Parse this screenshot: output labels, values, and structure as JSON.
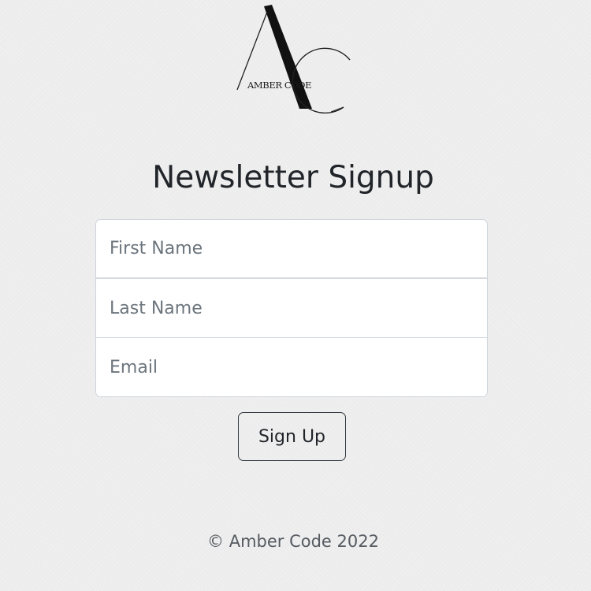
{
  "brand": {
    "logo_text": "AMBER CODE"
  },
  "title": "Newsletter Signup",
  "form": {
    "first_name_placeholder": "First Name",
    "last_name_placeholder": "Last Name",
    "email_placeholder": "Email",
    "submit_label": "Sign Up"
  },
  "footer": {
    "copyright": "© Amber Code 2022"
  },
  "colors": {
    "background": "#f0f0f0",
    "input_border": "#ced4da",
    "button_border": "#343a40",
    "placeholder": "#6c757d"
  }
}
